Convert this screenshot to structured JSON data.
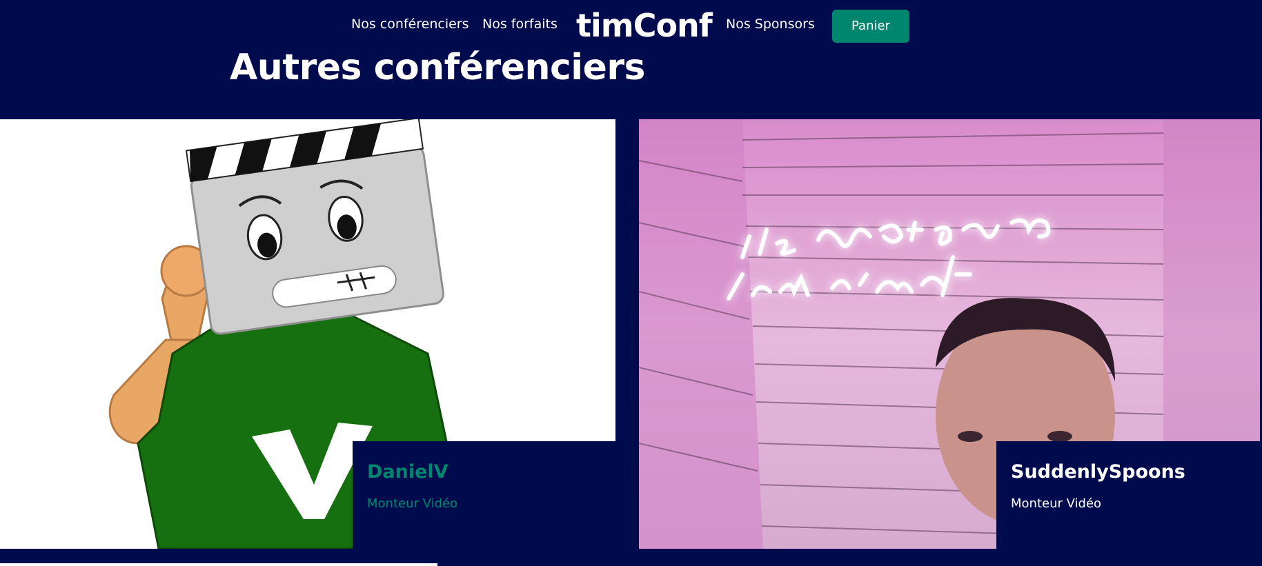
{
  "nav": {
    "speakers_label": "Nos conférenciers",
    "plans_label": "Nos forfaits",
    "logo_text": "timConf",
    "sponsors_label": "Nos Sponsors",
    "cart_label": "Panier"
  },
  "section": {
    "title": "Autres conférenciers"
  },
  "speakers": [
    {
      "name": "DanielV",
      "role": "Monteur Vidéo",
      "image_description_icon": "clapperboard-mascot"
    },
    {
      "name": "SuddenlySpoons",
      "role": "Monteur Vidéo",
      "neon_sign_text": "It's not gonna lick itself"
    }
  ],
  "colors": {
    "background": "#000b4e",
    "accent": "#00856f",
    "text": "#ffffff"
  }
}
